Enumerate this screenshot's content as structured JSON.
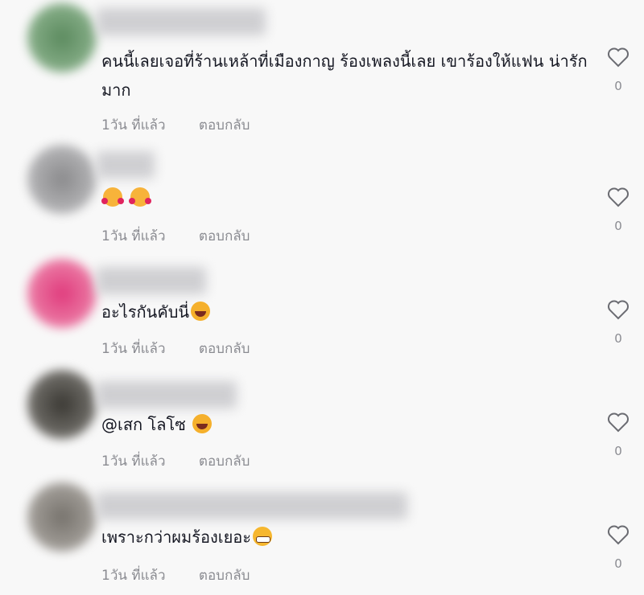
{
  "comments": [
    {
      "text": "คนนี้เลยเจอที่ร้านเหล้าที่เมืองกาญ ร้องเพลงนี้เลย เขาร้องให้แฟน น่ารักมาก",
      "time": "1วัน ที่แล้ว",
      "reply": "ตอบกลับ",
      "likes": "0"
    },
    {
      "text": "",
      "emojis": [
        "smiling-face-with-hearts-emoji",
        "smiling-face-with-hearts-emoji"
      ],
      "time": "1วัน ที่แล้ว",
      "reply": "ตอบกลับ",
      "likes": "0"
    },
    {
      "text": "อะไรกันคับนี่",
      "emojis": [
        "tears-of-joy-emoji"
      ],
      "time": "1วัน ที่แล้ว",
      "reply": "ตอบกลับ",
      "likes": "0"
    },
    {
      "text": "@เสก โลโซ",
      "emojis": [
        "tears-of-joy-emoji"
      ],
      "time": "1วัน ที่แล้ว",
      "reply": "ตอบกลับ",
      "likes": "0"
    },
    {
      "text": "เพราะกว่าผมร้องเยอะ",
      "emojis": [
        "grinning-face-emoji"
      ],
      "time": "1วัน ที่แล้ว",
      "reply": "ตอบกลับ",
      "likes": "0"
    }
  ],
  "colors": {
    "background": "#f8f8f8",
    "text": "#161823",
    "secondary": "#8a8b91"
  }
}
